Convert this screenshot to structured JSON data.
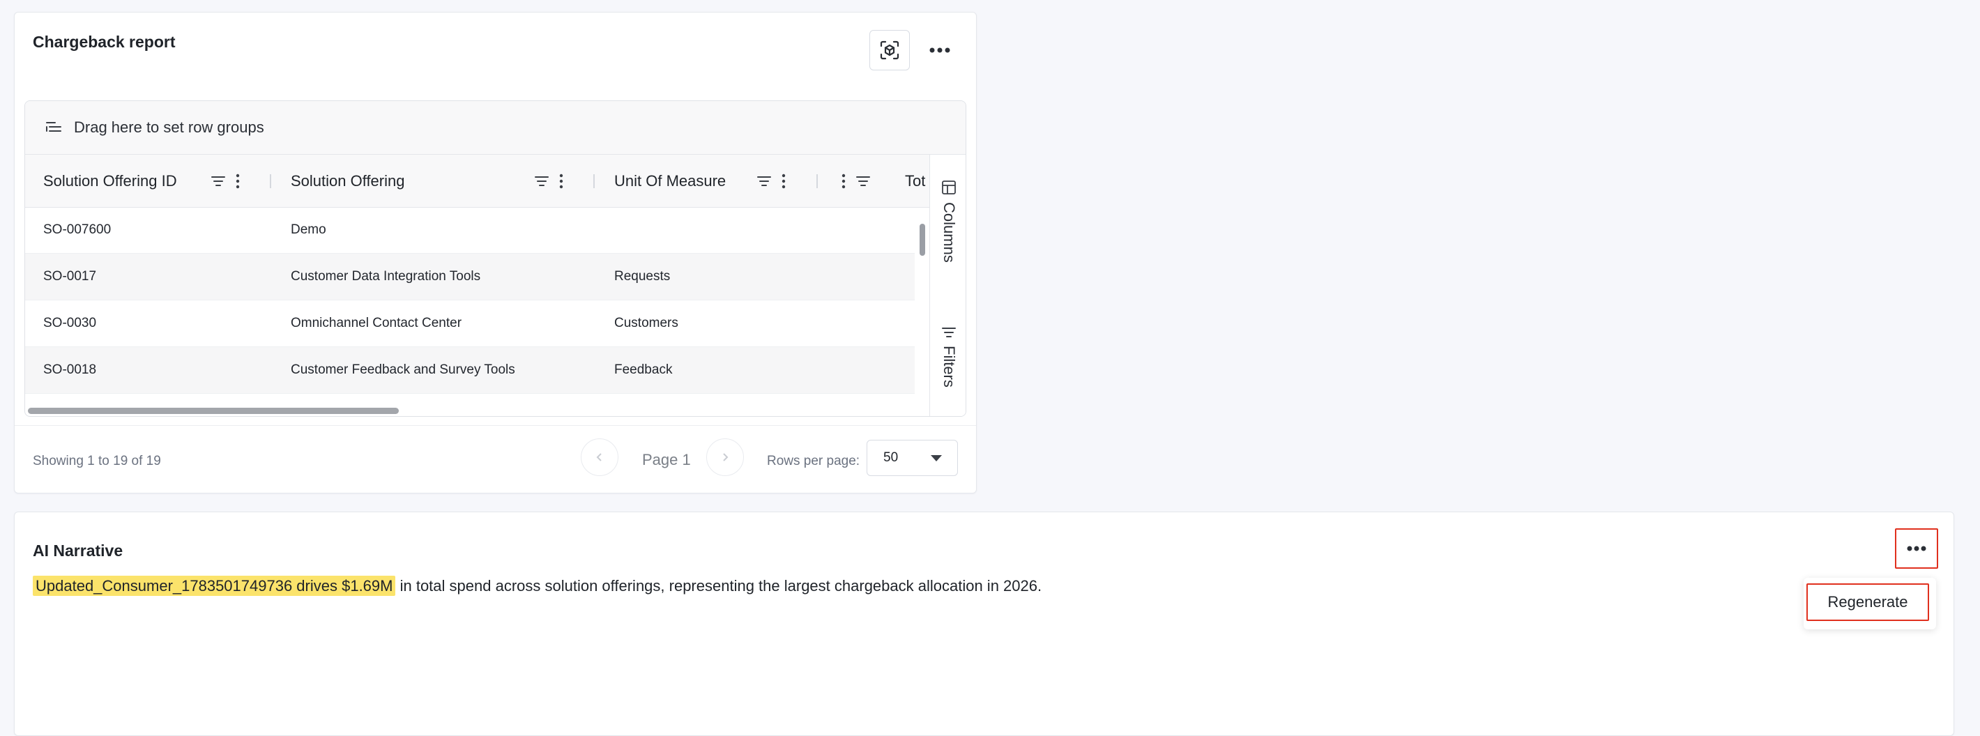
{
  "chargeback": {
    "title": "Chargeback report",
    "row_group_hint": "Drag here to set row groups",
    "columns": [
      "Solution Offering ID",
      "Solution Offering",
      "Unit Of Measure",
      "Tot"
    ],
    "rows": [
      {
        "id": "SO-007600",
        "offering": "Demo",
        "unit": ""
      },
      {
        "id": "SO-0017",
        "offering": "Customer Data Integration Tools",
        "unit": "Requests"
      },
      {
        "id": "SO-0030",
        "offering": "Omnichannel Contact Center",
        "unit": "Customers"
      },
      {
        "id": "SO-0018",
        "offering": "Customer Feedback and Survey Tools",
        "unit": "Feedback"
      }
    ],
    "side_tabs": {
      "columns": "Columns",
      "filters": "Filters"
    },
    "footer": {
      "showing": "Showing 1 to 19 of 19",
      "page": "Page 1",
      "rows_per_page_label": "Rows per page:",
      "rows_per_page_value": "50"
    }
  },
  "ai_narrative": {
    "title": "AI Narrative",
    "highlight": "Updated_Consumer_1783501749736 drives $1.69M",
    "text": " in total spend across solution offerings, representing the largest chargeback allocation in 2026.",
    "menu": {
      "regenerate": "Regenerate"
    }
  },
  "colors": {
    "accent_outline": "#e0301e",
    "highlight": "#fbe36b"
  }
}
